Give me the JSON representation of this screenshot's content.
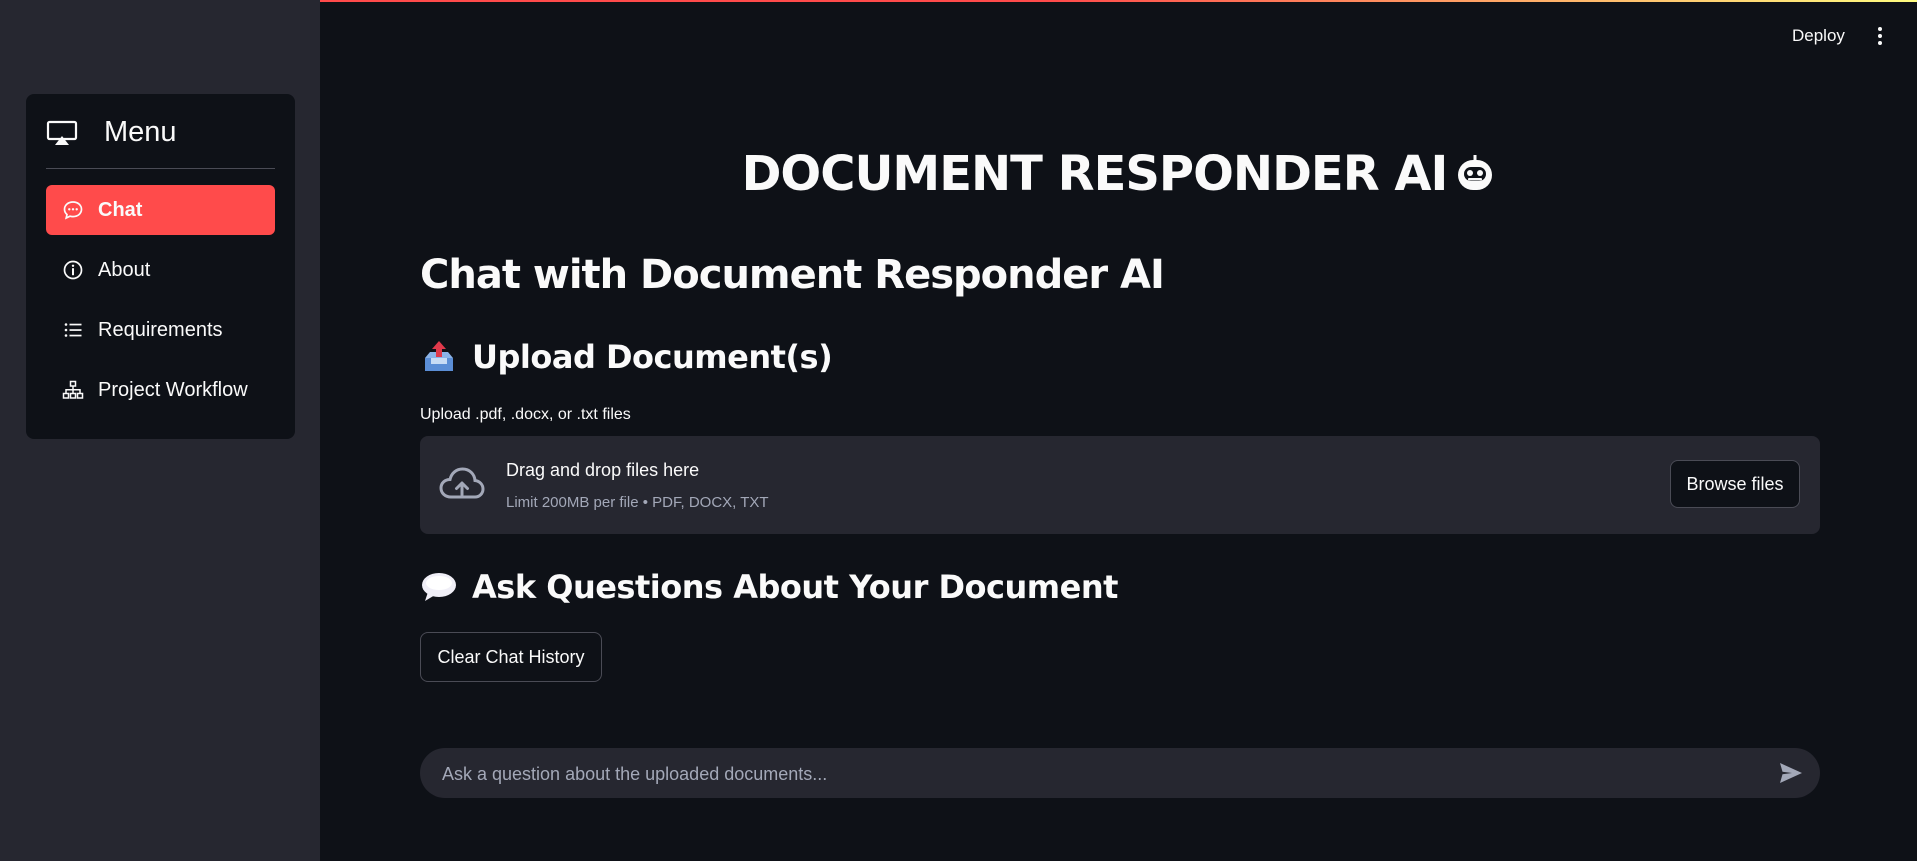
{
  "header": {
    "deploy_label": "Deploy",
    "menu_icon": "kebab-menu-icon"
  },
  "sidebar": {
    "menu_title": "Menu",
    "menu_icon": "airplay-icon",
    "items": [
      {
        "label": "Chat",
        "icon": "chat-bubble-icon",
        "active": true
      },
      {
        "label": "About",
        "icon": "info-icon",
        "active": false
      },
      {
        "label": "Requirements",
        "icon": "list-icon",
        "active": false
      },
      {
        "label": "Project Workflow",
        "icon": "sitemap-icon",
        "active": false
      }
    ]
  },
  "main": {
    "title": "DOCUMENT RESPONDER AI",
    "title_icon": "robot-emoji",
    "subtitle": "Chat with Document Responder AI",
    "upload_section": {
      "heading": "Upload Document(s)",
      "heading_icon": "outbox-tray-emoji",
      "label": "Upload .pdf, .docx, or .txt files",
      "drop_text": "Drag and drop files here",
      "limit_text": "Limit 200MB per file • PDF, DOCX, TXT",
      "browse_label": "Browse files",
      "upload_icon": "cloud-upload-icon"
    },
    "ask_section": {
      "heading": "Ask Questions About Your Document",
      "heading_icon": "speech-balloon-emoji",
      "clear_label": "Clear Chat History"
    },
    "chat_input": {
      "placeholder": "Ask a question about the uploaded documents...",
      "value": "",
      "send_icon": "send-icon"
    }
  },
  "colors": {
    "background": "#0e1117",
    "sidebar": "#262730",
    "accent": "#ff4b4b",
    "text": "#fafafa",
    "muted": "#a3a8b8"
  }
}
